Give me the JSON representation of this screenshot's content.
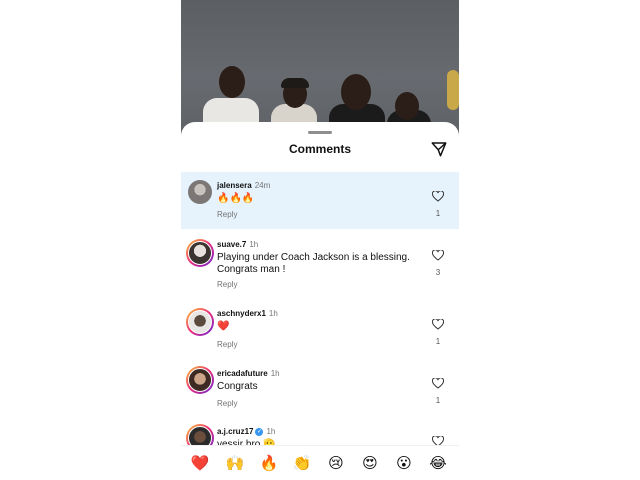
{
  "sheet": {
    "title": "Comments"
  },
  "comments": [
    {
      "username": "jalensera",
      "time": "24m",
      "verified": false,
      "text": "🔥🔥🔥",
      "reply": "Reply",
      "likes": "1",
      "highlighted": true
    },
    {
      "username": "suave.7",
      "time": "1h",
      "verified": false,
      "text": "Playing under Coach Jackson is a blessing. Congrats man !",
      "reply": "Reply",
      "likes": "3",
      "highlighted": false
    },
    {
      "username": "aschnyderx1",
      "time": "1h",
      "verified": false,
      "text": "❤️",
      "reply": "Reply",
      "likes": "1",
      "highlighted": false
    },
    {
      "username": "ericadafuture",
      "time": "1h",
      "verified": false,
      "text": "Congrats",
      "reply": "Reply",
      "likes": "1",
      "highlighted": false
    },
    {
      "username": "a.j.cruz17",
      "time": "1h",
      "verified": true,
      "text": "yessir bro 🫡",
      "reply": "",
      "likes": "",
      "highlighted": false
    }
  ],
  "emoji_bar": [
    "❤️",
    "🙌",
    "🔥",
    "👏",
    "😢",
    "😍",
    "😮",
    "😂"
  ],
  "colors": {
    "highlight": "#e6f3fd",
    "verified": "#3897f0",
    "muted": "#737373"
  }
}
